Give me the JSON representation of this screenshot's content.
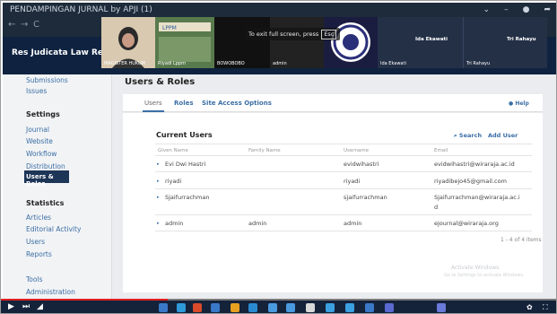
{
  "window": {
    "title": "PENDAMPINGAN JURNAL by APJI (1)"
  },
  "browser": {
    "back": "←",
    "forward": "→",
    "reload": "C"
  },
  "header": {
    "site_name": "Res Judicata Law Revie"
  },
  "meeting": {
    "tile_labels": [
      "MAGISTER HUKUM",
      "Riyadi Lppm",
      "BOWOBOBO",
      "admin",
      "Ida Ekawati",
      "Tri Rahayu"
    ],
    "name_ida": "Ida Ekawati",
    "name_tri": "Tri Rahayu",
    "fullscreen_notice": "To exit full screen, press",
    "esc_key": "Esc"
  },
  "sidebar": {
    "submissions": "Submissions",
    "issues": "Issues",
    "settings_heading": "Settings",
    "journal": "Journal",
    "website": "Website",
    "workflow": "Workflow",
    "distribution": "Distribution",
    "users_roles": "Users & Roles",
    "statistics_heading": "Statistics",
    "articles": "Articles",
    "editorial_activity": "Editorial Activity",
    "users": "Users",
    "reports": "Reports",
    "tools": "Tools",
    "administration": "Administration"
  },
  "main": {
    "page_title": "Users & Roles",
    "tabs": [
      "Users",
      "Roles",
      "Site Access Options"
    ],
    "help": "Help",
    "card_title": "Current Users",
    "search": "Search",
    "add_user": "Add User",
    "columns": [
      "Given Name",
      "Family Name",
      "Username",
      "Email"
    ],
    "rows": [
      {
        "given": "Evi Dwi Hastri",
        "family": "",
        "username": "evidwihastri",
        "email": "evidwihastri@wiraraja.ac.id"
      },
      {
        "given": "riyadi",
        "family": "",
        "username": "riyadi",
        "email": "riyadibejo45@gmail.com"
      },
      {
        "given": "Sjaifurrachman",
        "family": "",
        "username": "sjaifurrachman",
        "email": "Sjaifurrachman@wiraraja.ac.i"
      },
      {
        "given": "admin",
        "family": "admin",
        "username": "admin",
        "email": "ejournal@wiraraja.org"
      }
    ],
    "email_wrap": "d",
    "count": "1 - 4 of 4 items"
  },
  "watermark": {
    "line1": "Activate Windows",
    "line2": "Go to Settings to activate Windows."
  },
  "colors": {
    "header_bg": "#0f2340",
    "link": "#3b6fa6",
    "selected_nav": "#1d3557"
  }
}
